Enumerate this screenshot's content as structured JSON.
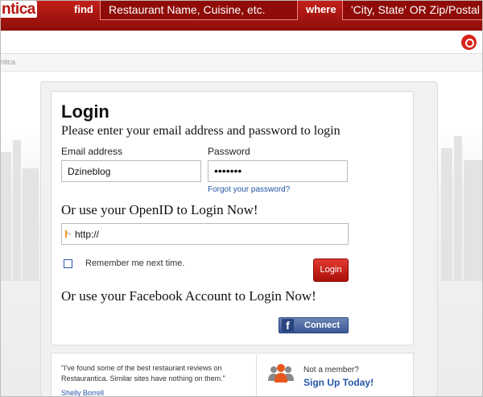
{
  "header": {
    "logo_text": "ntica",
    "find_label": "find",
    "search_placeholder": "Restaurant Name, Cuisine, etc.",
    "where_label": "where",
    "location_placeholder": "'City, State' OR Zip/Postal"
  },
  "breadcrumb": "ntica",
  "login": {
    "title": "Login",
    "subtitle": "Please enter your email address and password to login",
    "email_label": "Email address",
    "email_value": "Dzineblog",
    "password_label": "Password",
    "password_value": "•••••••",
    "forgot_link": "Forgot your password?",
    "openid_heading": "Or use your OpenID to Login Now!",
    "openid_value": "http://",
    "remember_label": "Remember me next time.",
    "login_button": "Login",
    "facebook_heading": "Or use your Facebook Account to Login Now!",
    "facebook_button": "Connect",
    "facebook_icon_letter": "f"
  },
  "testimonial": {
    "quote": "\"I've found some of the best restaurant reviews on Restaurantica. Similar sites have nothing on them.\"",
    "author": "Shelly Borrell"
  },
  "signup": {
    "prompt": "Not a member?",
    "link": "Sign Up Today!"
  },
  "colors": {
    "brand_red": "#b8160f",
    "link_blue": "#2456a6",
    "facebook_blue": "#3b5998"
  }
}
